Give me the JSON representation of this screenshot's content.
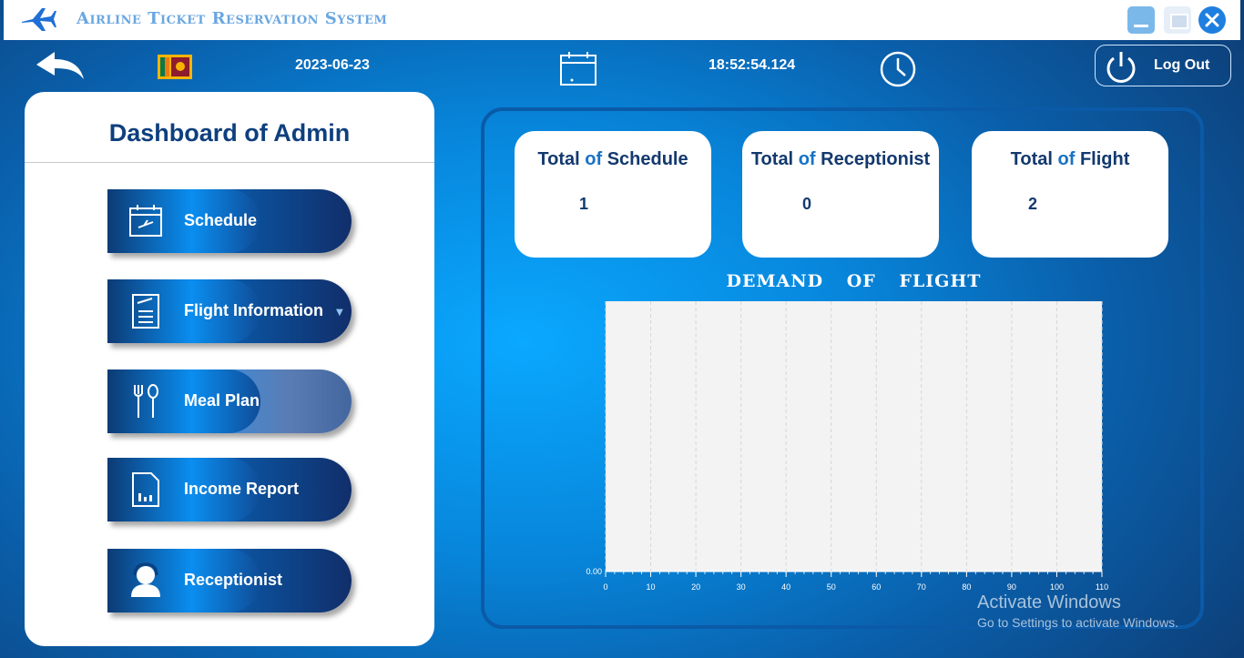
{
  "window": {
    "title": "Airline Ticket Reservation System"
  },
  "header": {
    "date": "2023-06-23",
    "time": "18:52:54.124",
    "logout_label": "Log Out"
  },
  "sidebar": {
    "title": "Dashboard of Admin",
    "items": [
      {
        "label": "Schedule",
        "icon": "schedule-icon"
      },
      {
        "label": "Flight Information",
        "icon": "flight-info-icon"
      },
      {
        "label": "Meal Plan",
        "icon": "meal-icon"
      },
      {
        "label": "Income Report",
        "icon": "report-icon"
      },
      {
        "label": "Receptionist",
        "icon": "receptionist-icon"
      }
    ]
  },
  "stats": [
    {
      "title_a": "Total",
      "title_of": "of",
      "title_b": "Schedule",
      "value": "1"
    },
    {
      "title_a": "Total",
      "title_of": "of",
      "title_b": "Receptionist",
      "value": "0"
    },
    {
      "title_a": "Total",
      "title_of": "of",
      "title_b": "Flight",
      "value": "2"
    }
  ],
  "chart_data": {
    "type": "bar",
    "title": "DEMAND OF FLIGHT",
    "xlim": [
      0,
      110
    ],
    "x_ticks": [
      "0",
      "10",
      "20",
      "30",
      "40",
      "50",
      "60",
      "70",
      "80",
      "90",
      "100",
      "110"
    ],
    "y_ticks": [
      "0.00"
    ],
    "values": [],
    "grid": true
  },
  "watermark": {
    "line1": "Activate Windows",
    "line2": "Go to Settings to activate Windows."
  },
  "colors": {
    "accent": "#0a8ef0",
    "dark_blue": "#0e3f7e"
  }
}
